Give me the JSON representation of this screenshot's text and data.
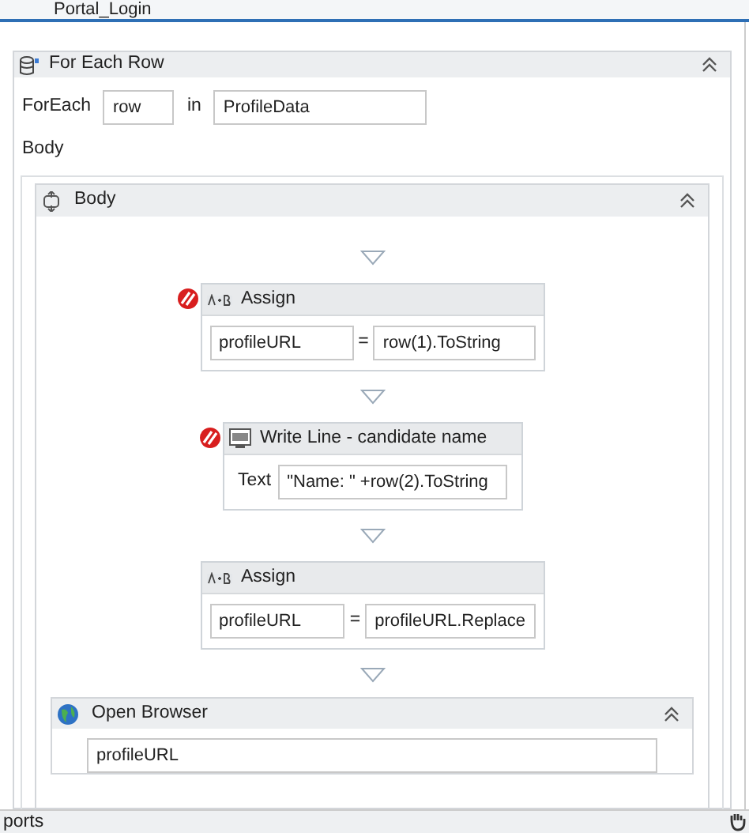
{
  "document_tab": {
    "title": "Portal_Login"
  },
  "for_each": {
    "title": "For Each Row",
    "foreach_label": "ForEach",
    "item_value": "row",
    "in_label": "in",
    "collection_value": "ProfileData",
    "body_label": "Body"
  },
  "body": {
    "title": "Body",
    "activities": [
      {
        "kind": "assign",
        "title": "Assign",
        "error": true,
        "target": "profileURL",
        "operator": "=",
        "value": "row(1).ToString"
      },
      {
        "kind": "writeline",
        "title": "Write Line - candidate name",
        "error": true,
        "label": "Text",
        "value": "\"Name: \" +row(2).ToString"
      },
      {
        "kind": "assign",
        "title": "Assign",
        "error": false,
        "target": "profileURL",
        "operator": "=",
        "value": "profileURL.Replace"
      }
    ]
  },
  "open_browser": {
    "title": "Open Browser",
    "url_value": "profileURL"
  },
  "bottom_panel": {
    "title": "ports"
  }
}
